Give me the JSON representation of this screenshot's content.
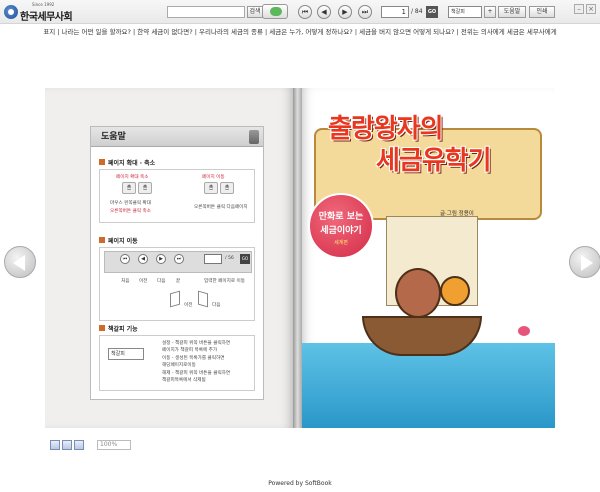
{
  "app": {
    "logo_since": "Since 1992",
    "logo_name": "한국세무사회"
  },
  "toolbar": {
    "search_placeholder": "",
    "search_label": "검색",
    "page_current": "1",
    "page_total": "/ 84",
    "go_label": "GO",
    "bookmark_select": "책갈피",
    "help_label": "도움말",
    "print_label": "인쇄"
  },
  "chapters": "표지 | 나라는 어떤 일을 할까요? | 한약 세금이 없다면? | 우리나라의 세금의 종류 | 세금은 누가, 어떻게 정하나요? | 세금을 버지 않으면 어떻게 되나요? | 전위는 의사에게 세금은 세무사에게",
  "help": {
    "title": "도움말",
    "sec1": {
      "title": "페이지 확대 · 축소",
      "left_label": "페이지 확대 축소",
      "left_desc1": "마우스 왼쪽클릭 확대",
      "left_desc2": "오른쪽버튼 클릭 축소",
      "right_label": "페이지 이동",
      "right_desc": "오른쪽버튼 클릭 다음페이지"
    },
    "sec2": {
      "title": "페이지 이동",
      "total": "/ 56",
      "go": "GO",
      "labels": [
        "처음",
        "이전",
        "다음",
        "끝"
      ],
      "input_desc": "입력한 페이지로 이동",
      "prev_label": "이전",
      "next_label": "다음"
    },
    "sec3": {
      "title": "책갈피 기능",
      "select_label": "책갈피",
      "desc1": "설정 - 책갈피 위쪽 버튼을 클릭하면",
      "desc2": "페이지가 책갈피 목록에 추가",
      "desc3": "이동 - 생성된 목록가를 클릭하면",
      "desc4": "해당페이지로이동",
      "desc5": "해제 - 책갈피 위쪽 버튼을 클릭하면",
      "desc6": "책갈피목록에서 삭제됨"
    }
  },
  "cover": {
    "title_line1": "출랑왕자의",
    "title_line2": "세금유학기",
    "author": "글·그림 정용이",
    "balloon_line1": "만화로 보는",
    "balloon_line2": "세금이야기",
    "balloon_line3": "세계편"
  },
  "bottom": {
    "zoom": "100%",
    "powered": "Powered by SoftBook"
  },
  "colors": {
    "accent_red": "#e8371e",
    "section_icon": "#d06a2a",
    "sea": "#2a97c9"
  }
}
